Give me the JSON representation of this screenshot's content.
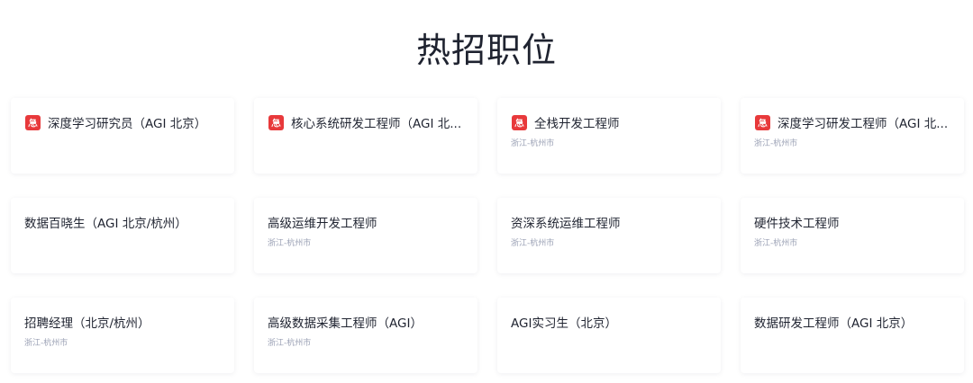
{
  "page": {
    "title": "热招职位"
  },
  "colors": {
    "urgent_badge": "#e8393b",
    "title_text": "#1f2330",
    "location_text": "#9aa0b4"
  },
  "jobs": [
    {
      "title": "深度学习研究员（AGI 北京）",
      "location": "",
      "urgent": true,
      "badge_icon": "urgent-icon"
    },
    {
      "title": "核心系统研发工程师（AGI 北...",
      "location": "",
      "urgent": true,
      "badge_icon": "urgent-icon"
    },
    {
      "title": "全栈开发工程师",
      "location": "浙江-杭州市",
      "urgent": true,
      "badge_icon": "urgent-icon"
    },
    {
      "title": "深度学习研发工程师（AGI 北...",
      "location": "浙江-杭州市",
      "urgent": true,
      "badge_icon": "urgent-icon"
    },
    {
      "title": "数据百晓生（AGI 北京/杭州）",
      "location": "",
      "urgent": false
    },
    {
      "title": "高级运维开发工程师",
      "location": "浙江-杭州市",
      "urgent": false
    },
    {
      "title": "资深系统运维工程师",
      "location": "浙江-杭州市",
      "urgent": false
    },
    {
      "title": "硬件技术工程师",
      "location": "浙江-杭州市",
      "urgent": false
    },
    {
      "title": "招聘经理（北京/杭州）",
      "location": "浙江-杭州市",
      "urgent": false
    },
    {
      "title": "高级数据采集工程师（AGI）",
      "location": "浙江-杭州市",
      "urgent": false
    },
    {
      "title": "AGI实习生（北京）",
      "location": "",
      "urgent": false
    },
    {
      "title": "数据研发工程师（AGI 北京）",
      "location": "",
      "urgent": false
    }
  ]
}
